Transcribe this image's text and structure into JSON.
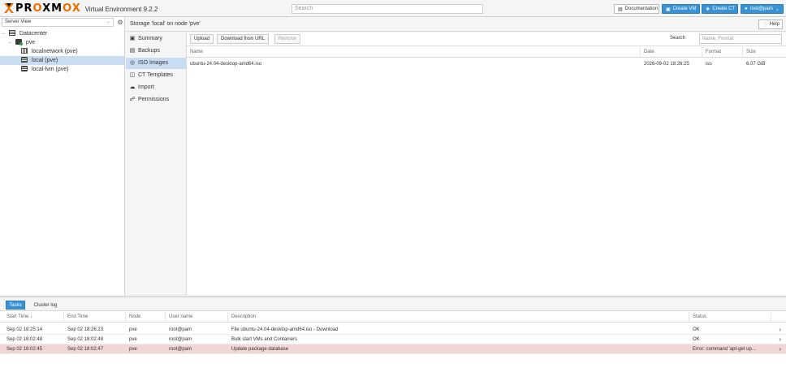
{
  "header": {
    "brand": "PROXMOX",
    "subtitle": "Virtual Environment 9.2.2",
    "search_placeholder": "Search",
    "docs_label": "Documentation",
    "create_vm_label": "Create VM",
    "create_ct_label": "Create CT",
    "user_label": "root@pam",
    "accent": "#e57000",
    "primary": "#3892d4"
  },
  "left": {
    "view_label": "Server View",
    "tree": [
      {
        "label": "Datacenter",
        "icon": "datacenter-icon",
        "level": 0
      },
      {
        "label": "pve",
        "icon": "node-icon",
        "level": 1
      },
      {
        "label": "localnetwork (pve)",
        "icon": "network-icon",
        "level": 2
      },
      {
        "label": "local (pve)",
        "icon": "storage-icon",
        "level": 2,
        "selected": true
      },
      {
        "label": "local-lvm (pve)",
        "icon": "storage-icon",
        "level": 2
      }
    ]
  },
  "content": {
    "title": "Storage 'local' on node 'pve'",
    "help_label": "Help",
    "nav": [
      {
        "label": "Summary",
        "icon": "summary-icon"
      },
      {
        "label": "Backups",
        "icon": "backup-icon"
      },
      {
        "label": "ISO Images",
        "icon": "iso-icon",
        "active": true
      },
      {
        "label": "CT Templates",
        "icon": "template-icon"
      },
      {
        "label": "Import",
        "icon": "import-icon"
      },
      {
        "label": "Permissions",
        "icon": "lock-icon"
      }
    ],
    "toolbar": {
      "upload_label": "Upload",
      "download_label": "Download from URL",
      "remove_label": "Remove",
      "search_label": "Search",
      "search_placeholder": "Name, Format"
    },
    "columns": [
      "Name",
      "Date",
      "Format",
      "Size"
    ],
    "rows": [
      {
        "name": "ubuntu-24.04-desktop-amd64.iso",
        "date": "2026-09-02 18:26:25",
        "format": "iso",
        "size": "6.07 GiB"
      }
    ]
  },
  "log": {
    "tabs": [
      "Tasks",
      "Cluster log"
    ],
    "columns": [
      "Start Time ↓",
      "End Time",
      "Node",
      "User name",
      "Description",
      "Status"
    ],
    "rows": [
      {
        "start": "Sep 02 18:25:14",
        "end": "Sep 02 18:26:23",
        "node": "pve",
        "user": "root@pam",
        "desc": "File ubuntu-24.04-desktop-amd64.iso - Download",
        "status": "OK",
        "error": false
      },
      {
        "start": "Sep 02 18:02:48",
        "end": "Sep 02 18:02:48",
        "node": "pve",
        "user": "root@pam",
        "desc": "Bulk start VMs and Containers",
        "status": "OK",
        "error": false
      },
      {
        "start": "Sep 02 18:02:45",
        "end": "Sep 02 18:02:47",
        "node": "pve",
        "user": "root@pam",
        "desc": "Update package database",
        "status": "Error: command 'apt-get up...",
        "error": true
      }
    ]
  }
}
